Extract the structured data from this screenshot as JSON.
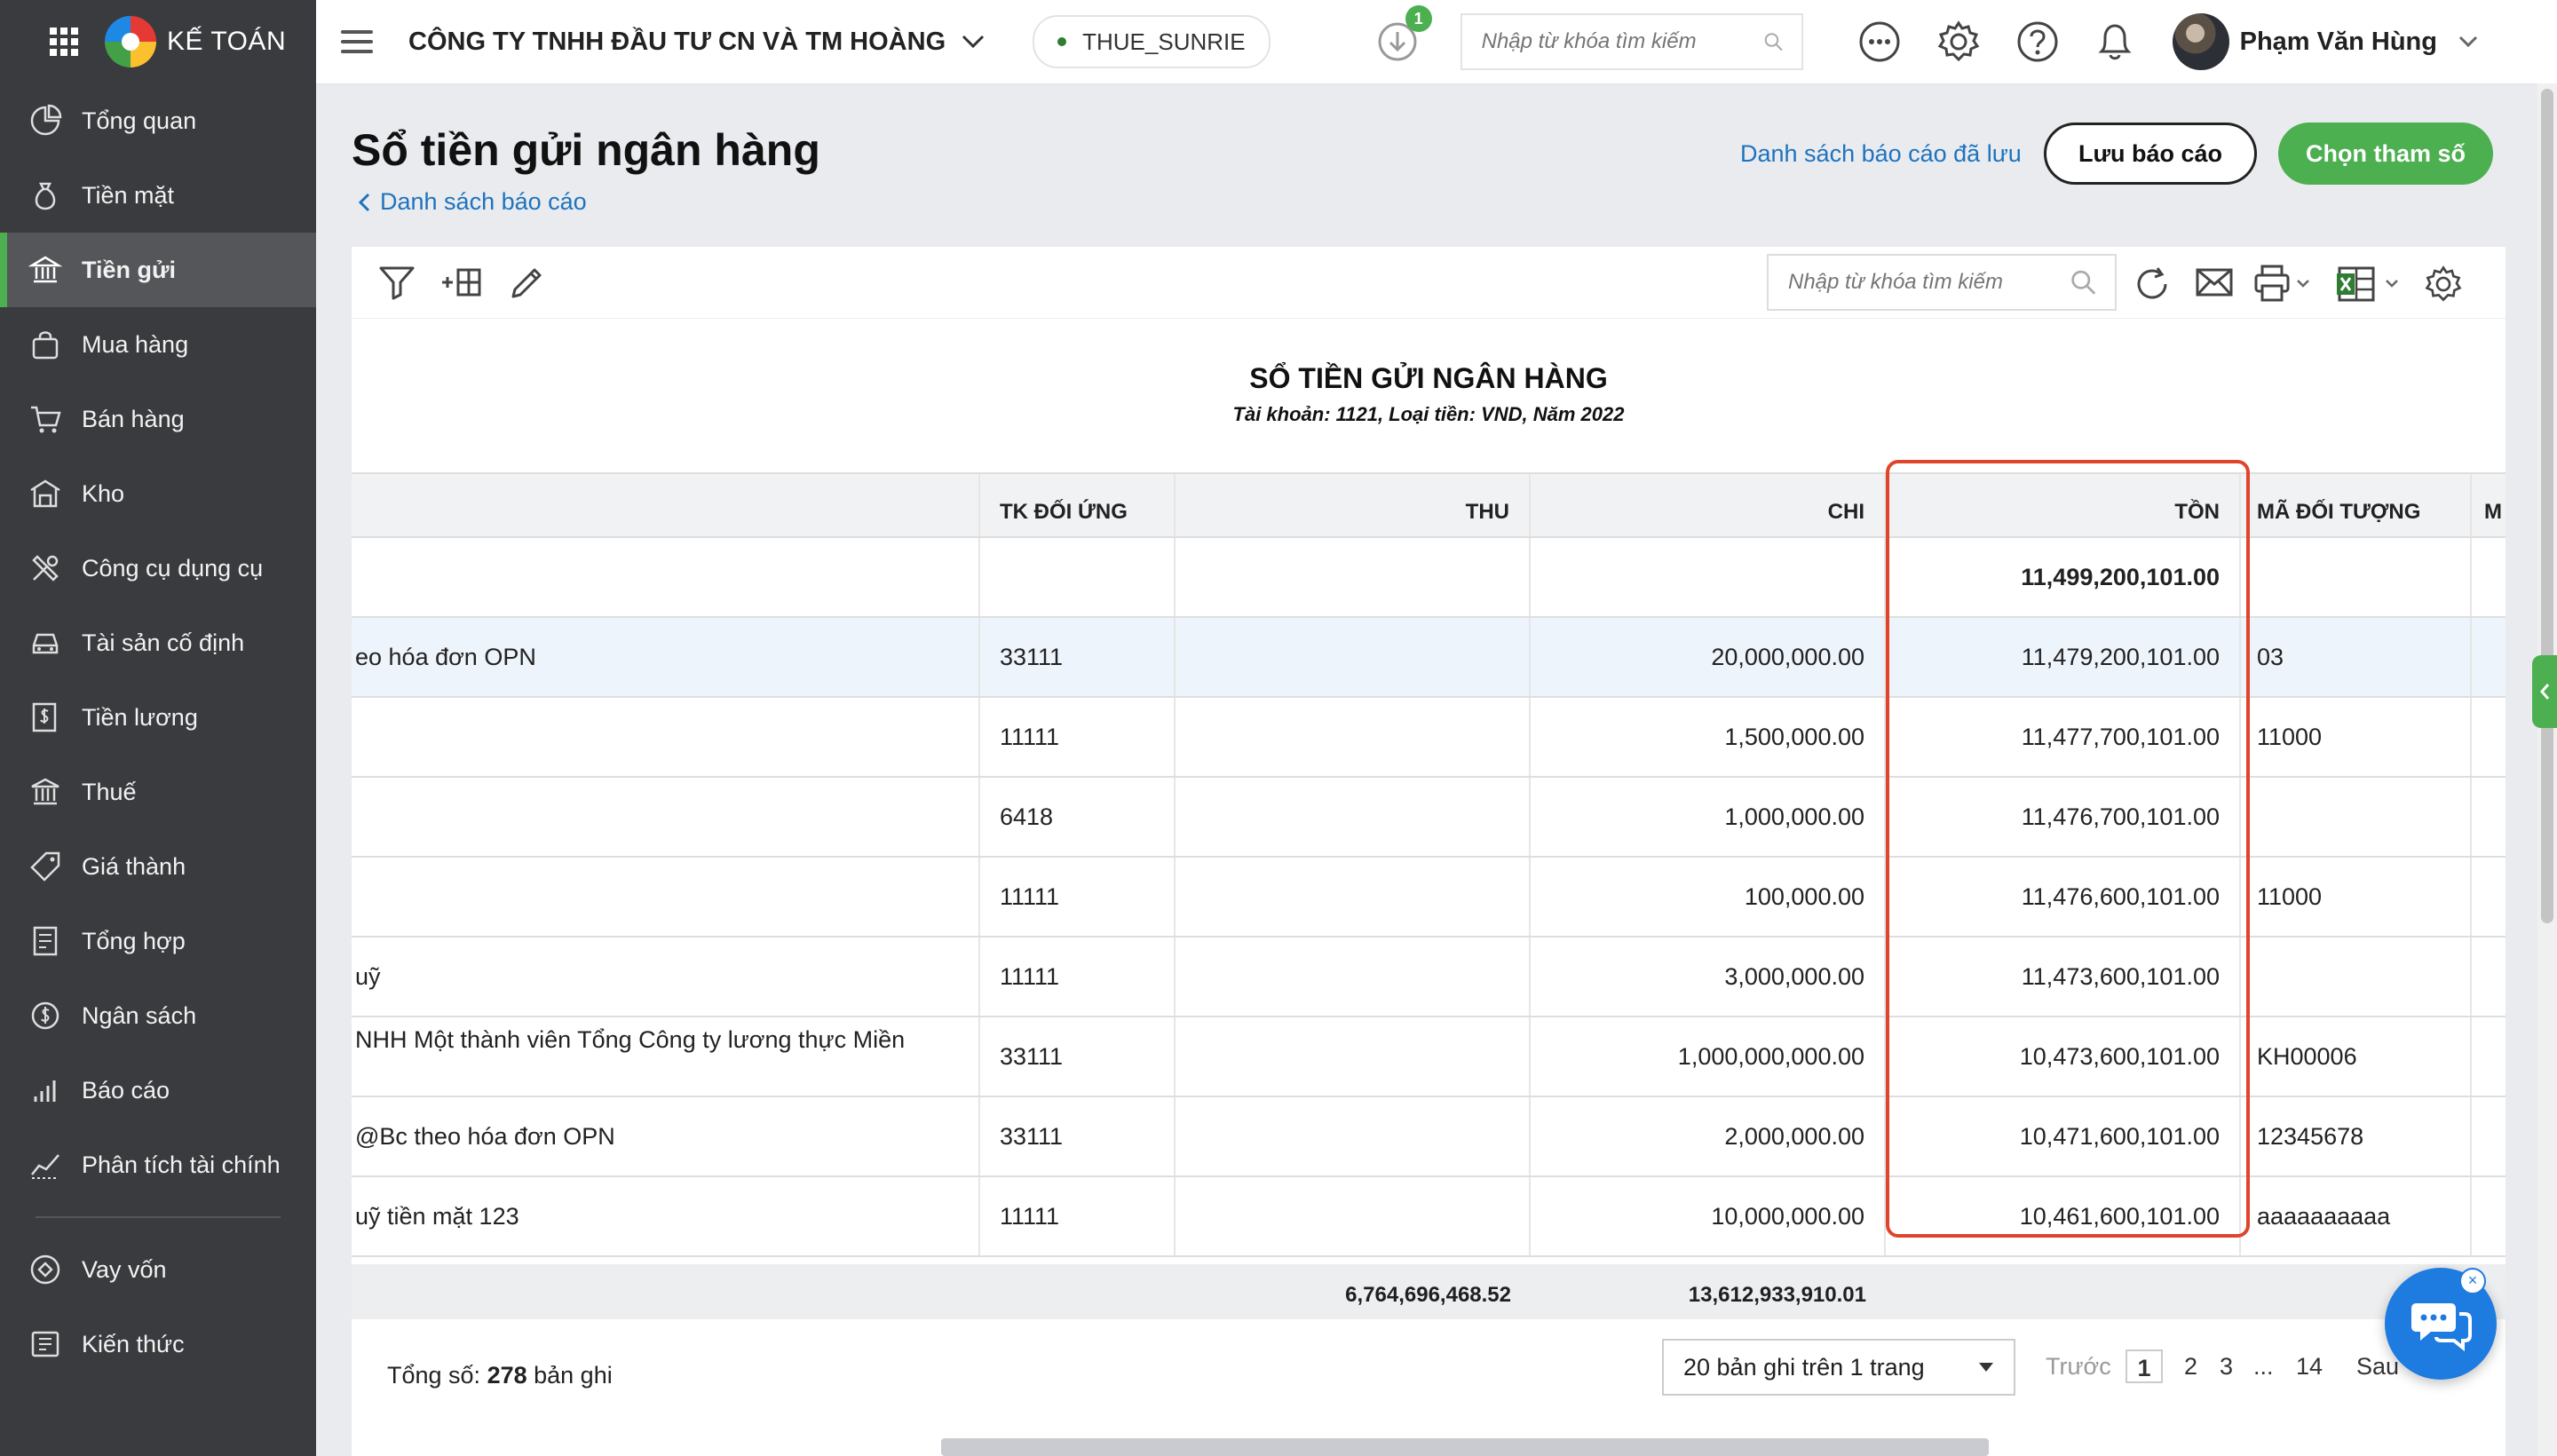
{
  "app": {
    "name": "KẾ TOÁN"
  },
  "sidebar": {
    "items": [
      {
        "label": "Tổng quan",
        "icon": "dashboard-icon"
      },
      {
        "label": "Tiền mặt",
        "icon": "money-bag-icon"
      },
      {
        "label": "Tiền gửi",
        "icon": "bank-icon",
        "active": true
      },
      {
        "label": "Mua hàng",
        "icon": "shopping-bag-icon"
      },
      {
        "label": "Bán hàng",
        "icon": "cart-icon"
      },
      {
        "label": "Kho",
        "icon": "warehouse-icon"
      },
      {
        "label": "Công cụ dụng cụ",
        "icon": "tools-icon"
      },
      {
        "label": "Tài sản cố định",
        "icon": "car-icon"
      },
      {
        "label": "Tiền lương",
        "icon": "salary-icon"
      },
      {
        "label": "Thuế",
        "icon": "tax-building-icon"
      },
      {
        "label": "Giá thành",
        "icon": "price-tag-icon"
      },
      {
        "label": "Tổng hợp",
        "icon": "summary-doc-icon"
      },
      {
        "label": "Ngân sách",
        "icon": "budget-icon"
      },
      {
        "label": "Báo cáo",
        "icon": "bar-chart-icon"
      },
      {
        "label": "Phân tích tài chính",
        "icon": "analytics-icon"
      }
    ],
    "items2": [
      {
        "label": "Vay vốn",
        "icon": "loan-icon"
      },
      {
        "label": "Kiến thức",
        "icon": "knowledge-icon"
      }
    ]
  },
  "header": {
    "company": "CÔNG TY TNHH ĐẦU TƯ CN VÀ TM HOÀNG",
    "database": "THUE_SUNRIE",
    "download_badge": "1",
    "search_placeholder": "Nhập từ khóa tìm kiếm",
    "user_name": "Phạm Văn Hùng"
  },
  "page": {
    "title": "Sổ tiền gửi ngân hàng",
    "back_link": "Danh sách báo cáo",
    "saved_reports_link": "Danh sách báo cáo đã lưu",
    "save_button": "Lưu báo cáo",
    "params_button": "Chọn tham số"
  },
  "toolbar": {
    "search_placeholder": "Nhập từ khóa tìm kiếm"
  },
  "report": {
    "title": "SỔ TIỀN GỬI NGÂN HÀNG",
    "subtitle": "Tài khoản: 1121, Loại tiền: VND, Năm 2022",
    "columns": [
      "",
      "TK ĐỐI ỨNG",
      "THU",
      "CHI",
      "TỒN",
      "MÃ ĐỐI TƯỢNG",
      "M"
    ],
    "opening": {
      "balance": "11,499,200,101.00"
    },
    "rows": [
      {
        "desc": "eo hóa đơn OPN",
        "account": "33111",
        "thu": "",
        "chi": "20,000,000.00",
        "balance": "11,479,200,101.00",
        "code": "03"
      },
      {
        "desc": "",
        "account": "11111",
        "thu": "",
        "chi": "1,500,000.00",
        "balance": "11,477,700,101.00",
        "code": "11000"
      },
      {
        "desc": "",
        "account": "6418",
        "thu": "",
        "chi": "1,000,000.00",
        "balance": "11,476,700,101.00",
        "code": ""
      },
      {
        "desc": "",
        "account": "11111",
        "thu": "",
        "chi": "100,000.00",
        "balance": "11,476,600,101.00",
        "code": "11000"
      },
      {
        "desc": "uỹ",
        "account": "11111",
        "thu": "",
        "chi": "3,000,000.00",
        "balance": "11,473,600,101.00",
        "code": ""
      },
      {
        "desc": "NHH Một thành viên Tổng Công ty lương thực Miền",
        "account": "33111",
        "thu": "",
        "chi": "1,000,000,000.00",
        "balance": "10,473,600,101.00",
        "code": "KH00006"
      },
      {
        "desc": "@Bc theo hóa đơn OPN",
        "account": "33111",
        "thu": "",
        "chi": "2,000,000.00",
        "balance": "10,471,600,101.00",
        "code": "12345678"
      },
      {
        "desc": "uỹ tiền mặt 123",
        "account": "11111",
        "thu": "",
        "chi": "10,000,000.00",
        "balance": "10,461,600,101.00",
        "code": "aaaaaaaaaa"
      }
    ],
    "totals": {
      "thu": "6,764,696,468.52",
      "chi": "13,612,933,910.01"
    }
  },
  "footer": {
    "total_label": "Tổng số: ",
    "total_count": "278",
    "total_suffix": " bản ghi",
    "per_page": "20 bản ghi trên 1 trang",
    "prev": "Trước",
    "pages": [
      "1",
      "2",
      "3",
      "...",
      "14"
    ],
    "next": "Sau"
  },
  "colors": {
    "accent_green": "#4caf50",
    "link_blue": "#1e73be",
    "highlight_red": "#e0442c",
    "sidebar_bg": "#3a3b3e"
  }
}
